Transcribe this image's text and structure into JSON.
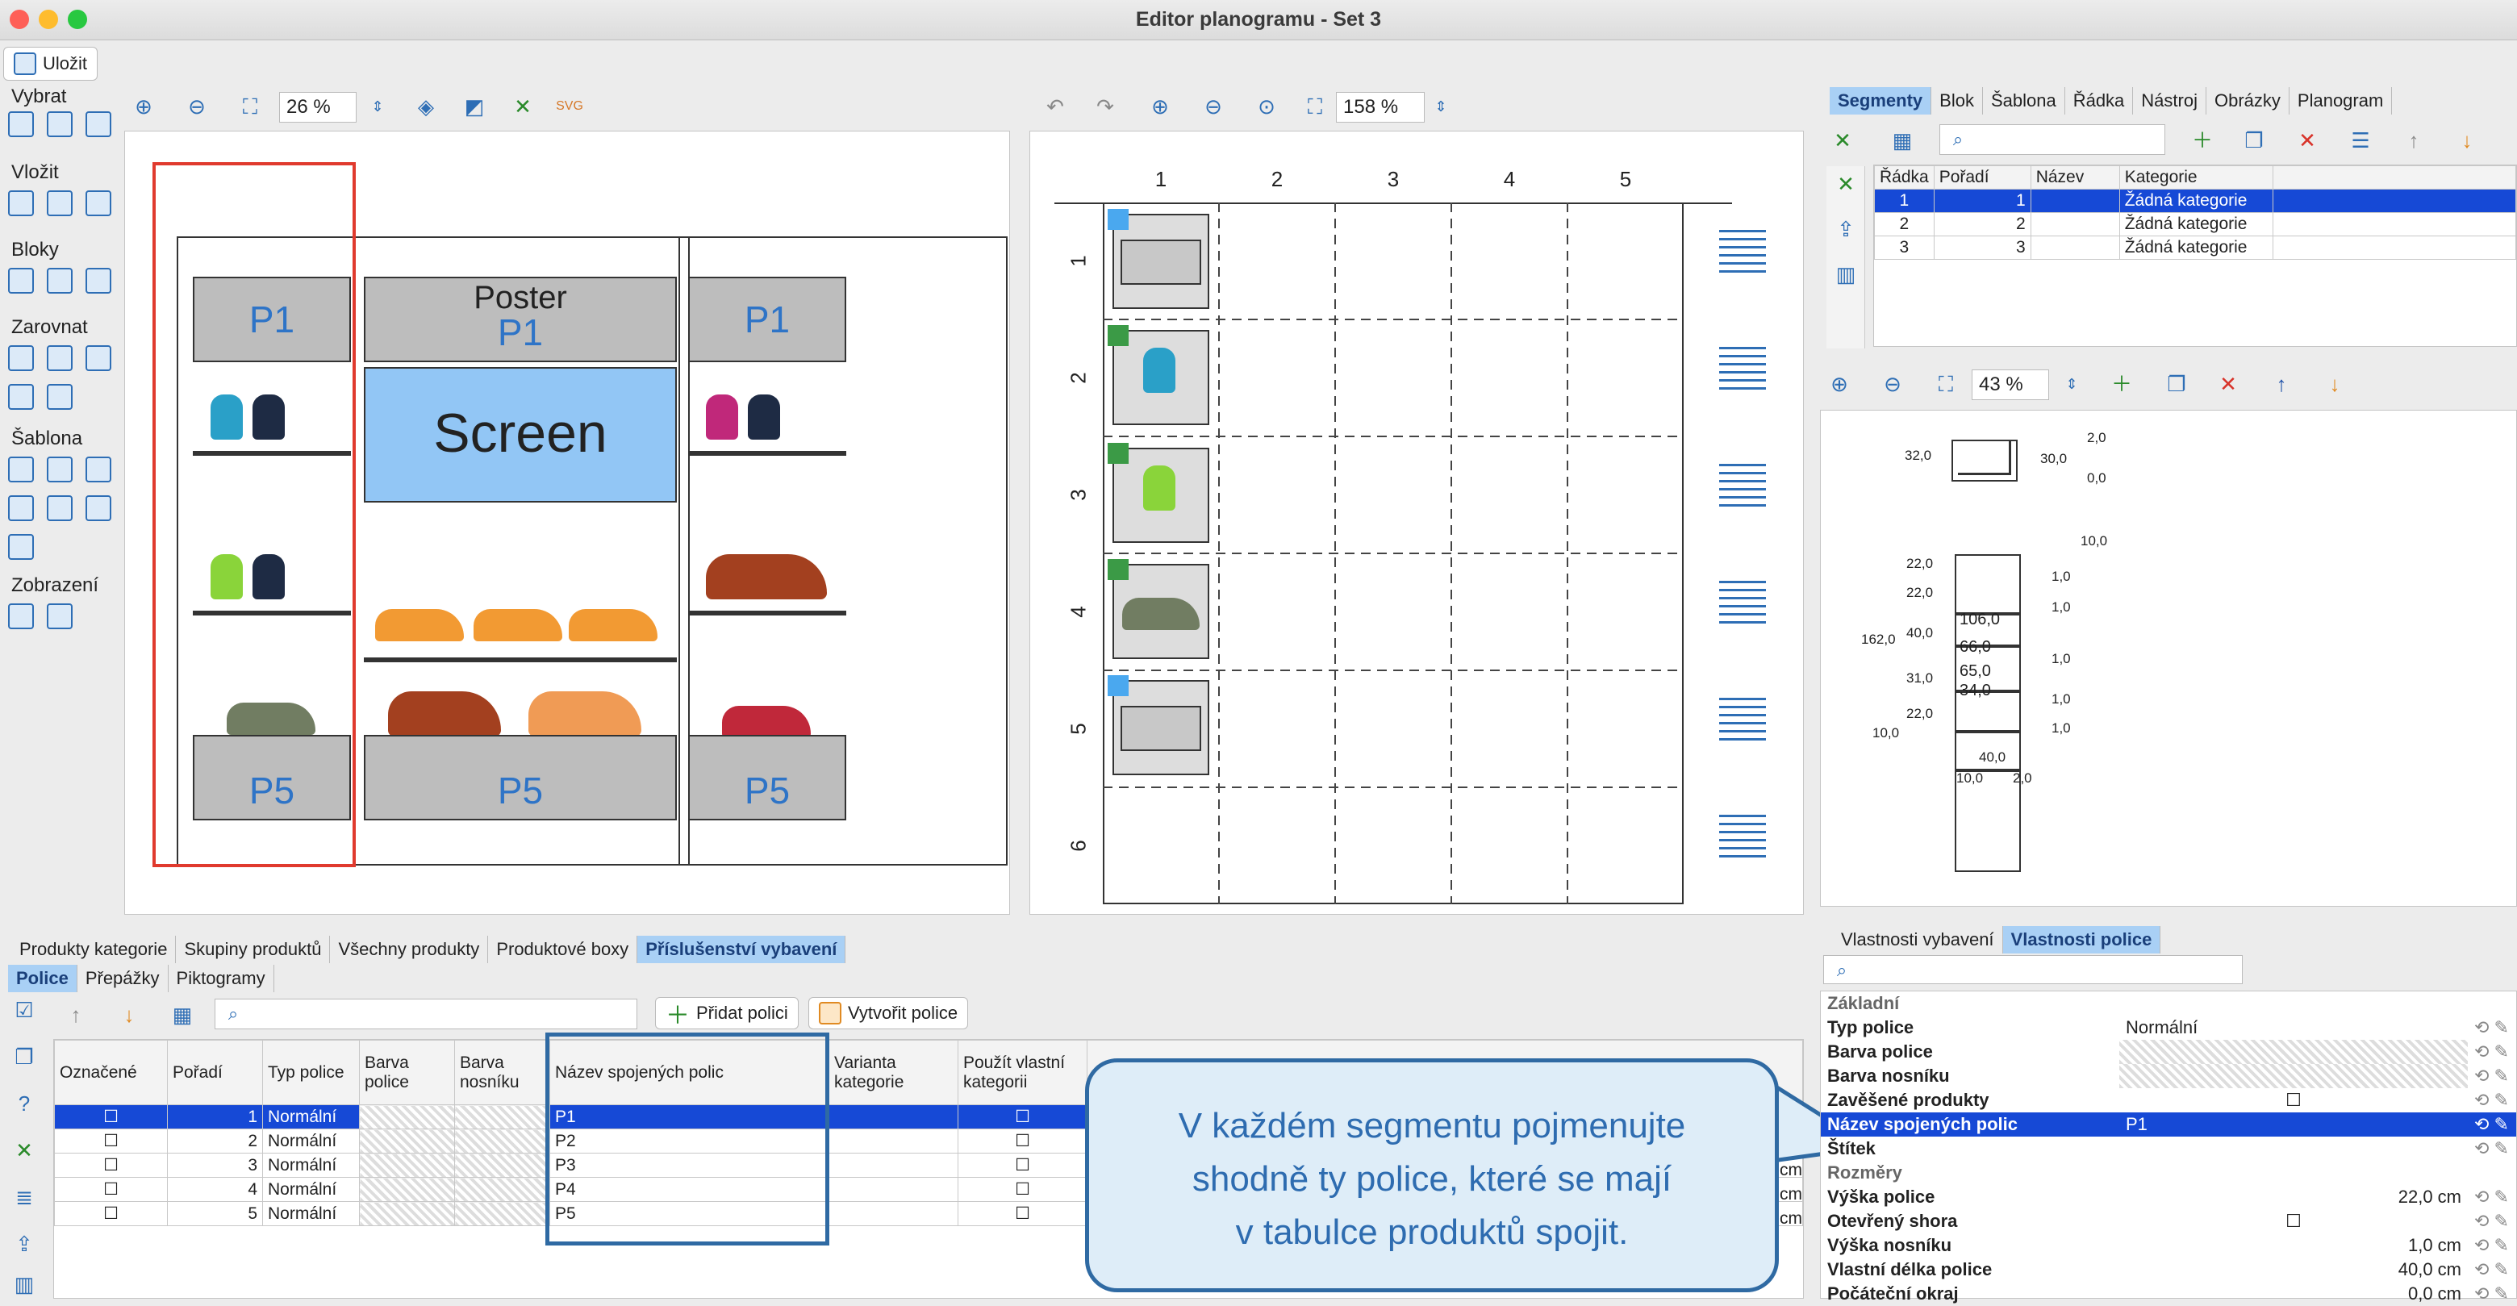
{
  "window": {
    "title": "Editor planogramu - Set 3"
  },
  "toolbar": {
    "save": "Uložit"
  },
  "left_groups": {
    "select": "Vybrat",
    "insert": "Vložit",
    "blocks": "Bloky",
    "align": "Zarovnat",
    "template": "Šablona",
    "view": "Zobrazení"
  },
  "zoom1": "26 %",
  "zoom2": "158 %",
  "zoom3": "43 %",
  "planogram": {
    "poster": "Poster",
    "screen": "Screen",
    "labels": [
      "P1",
      "P1",
      "P1",
      "P5",
      "P5",
      "P5"
    ]
  },
  "grid": {
    "cols": [
      "1",
      "2",
      "3",
      "4",
      "5"
    ],
    "rows": [
      "1",
      "2",
      "3",
      "4",
      "5",
      "6"
    ]
  },
  "seg_tabs": [
    "Segmenty",
    "Blok",
    "Šablona",
    "Řádka",
    "Nástroj",
    "Obrázky",
    "Planogram"
  ],
  "seg_table": {
    "headers": [
      "Řádka",
      "Pořadí",
      "Název",
      "Kategorie"
    ],
    "rows": [
      [
        "1",
        "1",
        "",
        "Žádná kategorie"
      ],
      [
        "2",
        "2",
        "",
        "Žádná kategorie"
      ],
      [
        "3",
        "3",
        "",
        "Žádná kategorie"
      ]
    ]
  },
  "dims": [
    "32,0",
    "2,0",
    "30,0",
    "0,0",
    "10,0",
    "22,0",
    "1,0",
    "22,0",
    "1,0",
    "162,0",
    "40,0",
    "1,0",
    "31,0",
    "1,0",
    "22,0",
    "1,0",
    "10,0",
    "40,0",
    "10,0",
    "2,0",
    "106,0",
    "66,0",
    "65,0",
    "34,0"
  ],
  "bottom_tabs": [
    "Produkty kategorie",
    "Skupiny produktů",
    "Všechny produkty",
    "Produktové boxy",
    "Příslušenství vybavení"
  ],
  "sub_tabs": [
    "Police",
    "Přepážky",
    "Piktogramy"
  ],
  "buttons": {
    "add_shelf": "Přidat polici",
    "create_shelves": "Vytvořit police"
  },
  "shelf_table": {
    "headers": [
      "Označené",
      "Pořadí",
      "Typ police",
      "Barva police",
      "Barva nosníku",
      "Název spojených polic",
      "Varianta kategorie",
      "Použít vlastní kategorii"
    ],
    "rows": [
      [
        "",
        "1",
        "Normální",
        "P1"
      ],
      [
        "",
        "2",
        "Normální",
        "P2"
      ],
      [
        "",
        "3",
        "Normální",
        "P3"
      ],
      [
        "",
        "4",
        "Normální",
        "P4"
      ],
      [
        "",
        "5",
        "Normální",
        "P5"
      ]
    ],
    "unit": "cm"
  },
  "prop_tabs": [
    "Vlastnosti vybavení",
    "Vlastnosti police"
  ],
  "props": {
    "sec1": "Základní",
    "sec2": "Rozměry",
    "rows": [
      [
        "Typ police",
        "Normální"
      ],
      [
        "Barva police",
        ""
      ],
      [
        "Barva nosníku",
        ""
      ],
      [
        "Zavěšené produkty",
        ""
      ],
      [
        "Název spojených polic",
        "P1"
      ],
      [
        "Štítek",
        ""
      ]
    ],
    "rows2": [
      [
        "Výška police",
        "22,0 cm"
      ],
      [
        "Otevřený shora",
        ""
      ],
      [
        "Výška nosníku",
        "1,0 cm"
      ],
      [
        "Vlastní délka police",
        "40,0 cm"
      ],
      [
        "Počáteční okraj",
        "0,0 cm"
      ]
    ]
  },
  "callout": [
    "V každém segmentu pojmenujte",
    "shodně ty police, které se mají",
    "v tabulce produktů spojit."
  ],
  "colors": {
    "accent": "#2e6eb5",
    "selection": "#1649d6",
    "highlight": "#2f6aa3"
  }
}
